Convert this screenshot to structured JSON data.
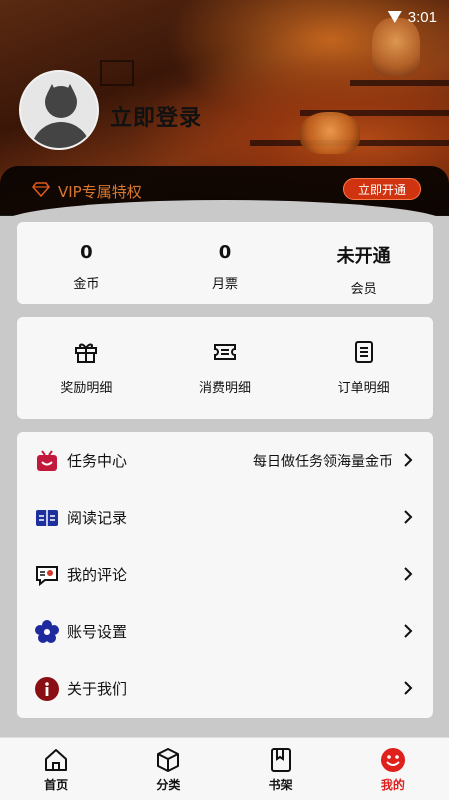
{
  "status_bar": {
    "time": "3:01"
  },
  "profile": {
    "login_label": "立即登录"
  },
  "vip": {
    "text": "VIP专属特权",
    "button_label": "立即开通"
  },
  "stats": [
    {
      "value": "0",
      "label": "金币"
    },
    {
      "value": "0",
      "label": "月票"
    },
    {
      "value": "未开通",
      "label": "会员"
    }
  ],
  "details": [
    {
      "label": "奖励明细",
      "icon": "gift-icon"
    },
    {
      "label": "消费明细",
      "icon": "ticket-icon"
    },
    {
      "label": "订单明细",
      "icon": "receipt-icon"
    }
  ],
  "menu": [
    {
      "label": "任务中心",
      "extra": "每日做任务领海量金币",
      "icon": "tv-icon"
    },
    {
      "label": "阅读记录",
      "extra": "",
      "icon": "book-icon"
    },
    {
      "label": "我的评论",
      "extra": "",
      "icon": "comment-icon"
    },
    {
      "label": "账号设置",
      "extra": "",
      "icon": "flower-settings-icon"
    },
    {
      "label": "关于我们",
      "extra": "",
      "icon": "info-icon"
    }
  ],
  "nav": [
    {
      "label": "首页",
      "icon": "home-icon"
    },
    {
      "label": "分类",
      "icon": "cube-icon"
    },
    {
      "label": "书架",
      "icon": "bookshelf-icon"
    },
    {
      "label": "我的",
      "icon": "smiley-icon"
    }
  ],
  "colors": {
    "accent": "#e0201c",
    "vip_text": "#d9772e",
    "vip_button": "#d0330f"
  }
}
